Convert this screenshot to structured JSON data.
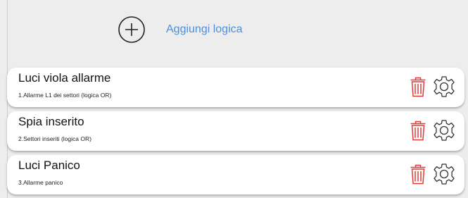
{
  "header": {
    "add_label": "Aggiungi logica",
    "add_icon": "plus-circle-icon",
    "accent_color": "#4a90e2"
  },
  "logics": [
    {
      "title": "Luci viola allarme",
      "subtitle": "1.Allarme L1 dei settori (logica OR)",
      "delete_icon": "trash-icon",
      "settings_icon": "gear-icon"
    },
    {
      "title": "Spia inserito",
      "subtitle": "2.Settori inseriti (logica OR)",
      "delete_icon": "trash-icon",
      "settings_icon": "gear-icon"
    },
    {
      "title": "Luci Panico",
      "subtitle": "3.Allarme panico",
      "delete_icon": "trash-icon",
      "settings_icon": "gear-icon"
    }
  ],
  "colors": {
    "background": "#ededed",
    "card": "#ffffff",
    "delete": "#e53935",
    "icon_outline": "#333333"
  }
}
